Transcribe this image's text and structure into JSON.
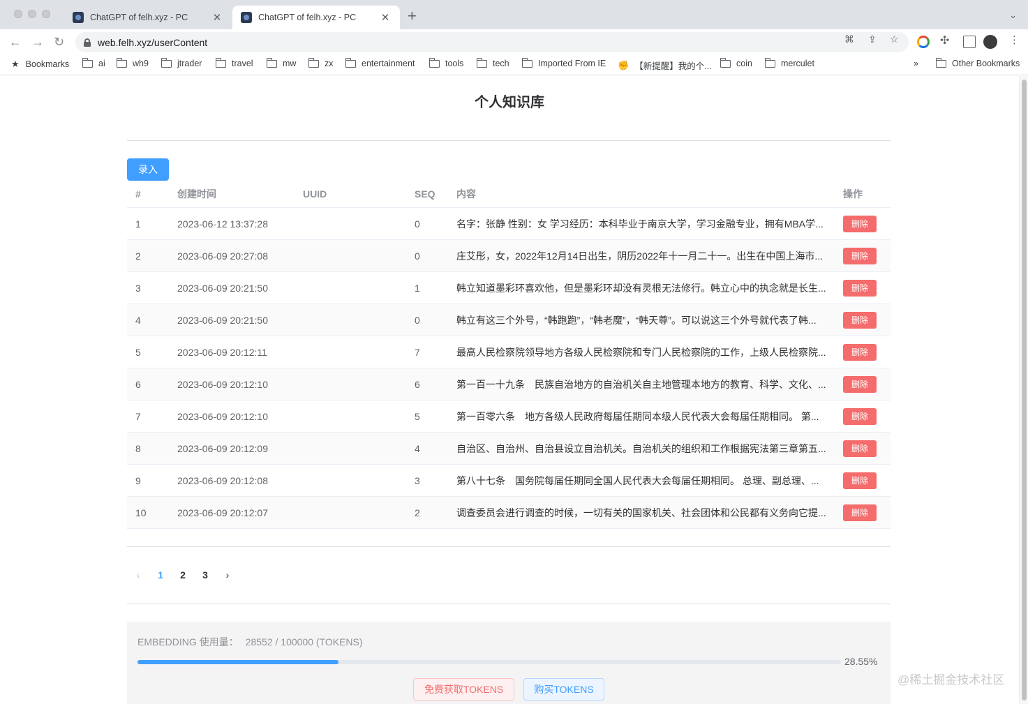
{
  "browser": {
    "tabs": [
      {
        "title": "ChatGPT of felh.xyz - PC",
        "active": false
      },
      {
        "title": "ChatGPT of felh.xyz - PC",
        "active": true
      }
    ],
    "new_tab": "+",
    "url": "web.felh.xyz/userContent",
    "bookmarks": [
      {
        "label": "Bookmarks",
        "icon": "star-icon"
      },
      {
        "label": "ai",
        "icon": "folder-icon"
      },
      {
        "label": "wh9",
        "icon": "folder-icon"
      },
      {
        "label": "jtrader",
        "icon": "folder-icon"
      },
      {
        "label": "travel",
        "icon": "folder-icon"
      },
      {
        "label": "mw",
        "icon": "folder-icon"
      },
      {
        "label": "zx",
        "icon": "folder-icon"
      },
      {
        "label": "entertainment",
        "icon": "folder-icon"
      },
      {
        "label": "tools",
        "icon": "folder-icon"
      },
      {
        "label": "tech",
        "icon": "folder-icon"
      },
      {
        "label": "Imported From IE",
        "icon": "folder-icon"
      },
      {
        "label": "【新提醒】我的个...",
        "icon": "handshake-icon"
      },
      {
        "label": "coin",
        "icon": "folder-icon"
      },
      {
        "label": "merculet",
        "icon": "folder-icon"
      }
    ],
    "more_bookmarks": "»",
    "other_bookmarks": "Other Bookmarks"
  },
  "page": {
    "title": "个人知识库",
    "add_button": "录入",
    "table": {
      "headers": {
        "index": "#",
        "created": "创建时间",
        "uuid": "UUID",
        "seq": "SEQ",
        "content": "内容",
        "op": "操作"
      },
      "delete_label": "删除",
      "rows": [
        {
          "index": "1",
          "created": "2023-06-12 13:37:28",
          "uuid": "",
          "seq": "0",
          "content": "名字：张静 性别：女 学习经历：本科毕业于南京大学，学习金融专业，拥有MBA学..."
        },
        {
          "index": "2",
          "created": "2023-06-09 20:27:08",
          "uuid": "",
          "seq": "0",
          "content": "庄艾彤，女，2022年12月14日出生，阴历2022年十一月二十一。出生在中国上海市..."
        },
        {
          "index": "3",
          "created": "2023-06-09 20:21:50",
          "uuid": "",
          "seq": "1",
          "content": "韩立知道墨彩环喜欢他，但是墨彩环却没有灵根无法修行。韩立心中的执念就是长生..."
        },
        {
          "index": "4",
          "created": "2023-06-09 20:21:50",
          "uuid": "",
          "seq": "0",
          "content": "韩立有这三个外号，“韩跑跑”，“韩老魔”，“韩天尊”。可以说这三个外号就代表了韩..."
        },
        {
          "index": "5",
          "created": "2023-06-09 20:12:11",
          "uuid": "",
          "seq": "7",
          "content": "最高人民检察院领导地方各级人民检察院和专门人民检察院的工作，上级人民检察院..."
        },
        {
          "index": "6",
          "created": "2023-06-09 20:12:10",
          "uuid": "",
          "seq": "6",
          "content": "第一百一十九条　民族自治地方的自治机关自主地管理本地方的教育、科学、文化、..."
        },
        {
          "index": "7",
          "created": "2023-06-09 20:12:10",
          "uuid": "",
          "seq": "5",
          "content": "第一百零六条　地方各级人民政府每届任期同本级人民代表大会每届任期相同。 第..."
        },
        {
          "index": "8",
          "created": "2023-06-09 20:12:09",
          "uuid": "",
          "seq": "4",
          "content": "自治区、自治州、自治县设立自治机关。自治机关的组织和工作根据宪法第三章第五..."
        },
        {
          "index": "9",
          "created": "2023-06-09 20:12:08",
          "uuid": "",
          "seq": "3",
          "content": "第八十七条　国务院每届任期同全国人民代表大会每届任期相同。 总理、副总理、..."
        },
        {
          "index": "10",
          "created": "2023-06-09 20:12:07",
          "uuid": "",
          "seq": "2",
          "content": "调查委员会进行调查的时候，一切有关的国家机关、社会团体和公民都有义务向它提..."
        }
      ]
    },
    "pagination": {
      "prev": "‹",
      "pages": [
        "1",
        "2",
        "3"
      ],
      "active": 0,
      "next": "›"
    },
    "usage": {
      "label": "EMBEDDING 使用量：",
      "value": "28552 / 100000 (TOKENS)",
      "progress_fraction": 0.2855,
      "progress_text": "28.55%",
      "free_button": "免费获取TOKENS",
      "buy_button": "购买TOKENS"
    },
    "watermark": "@稀土掘金技术社区"
  },
  "colors": {
    "primary": "#409eff",
    "danger": "#f56c6c",
    "header_text": "#909399"
  }
}
